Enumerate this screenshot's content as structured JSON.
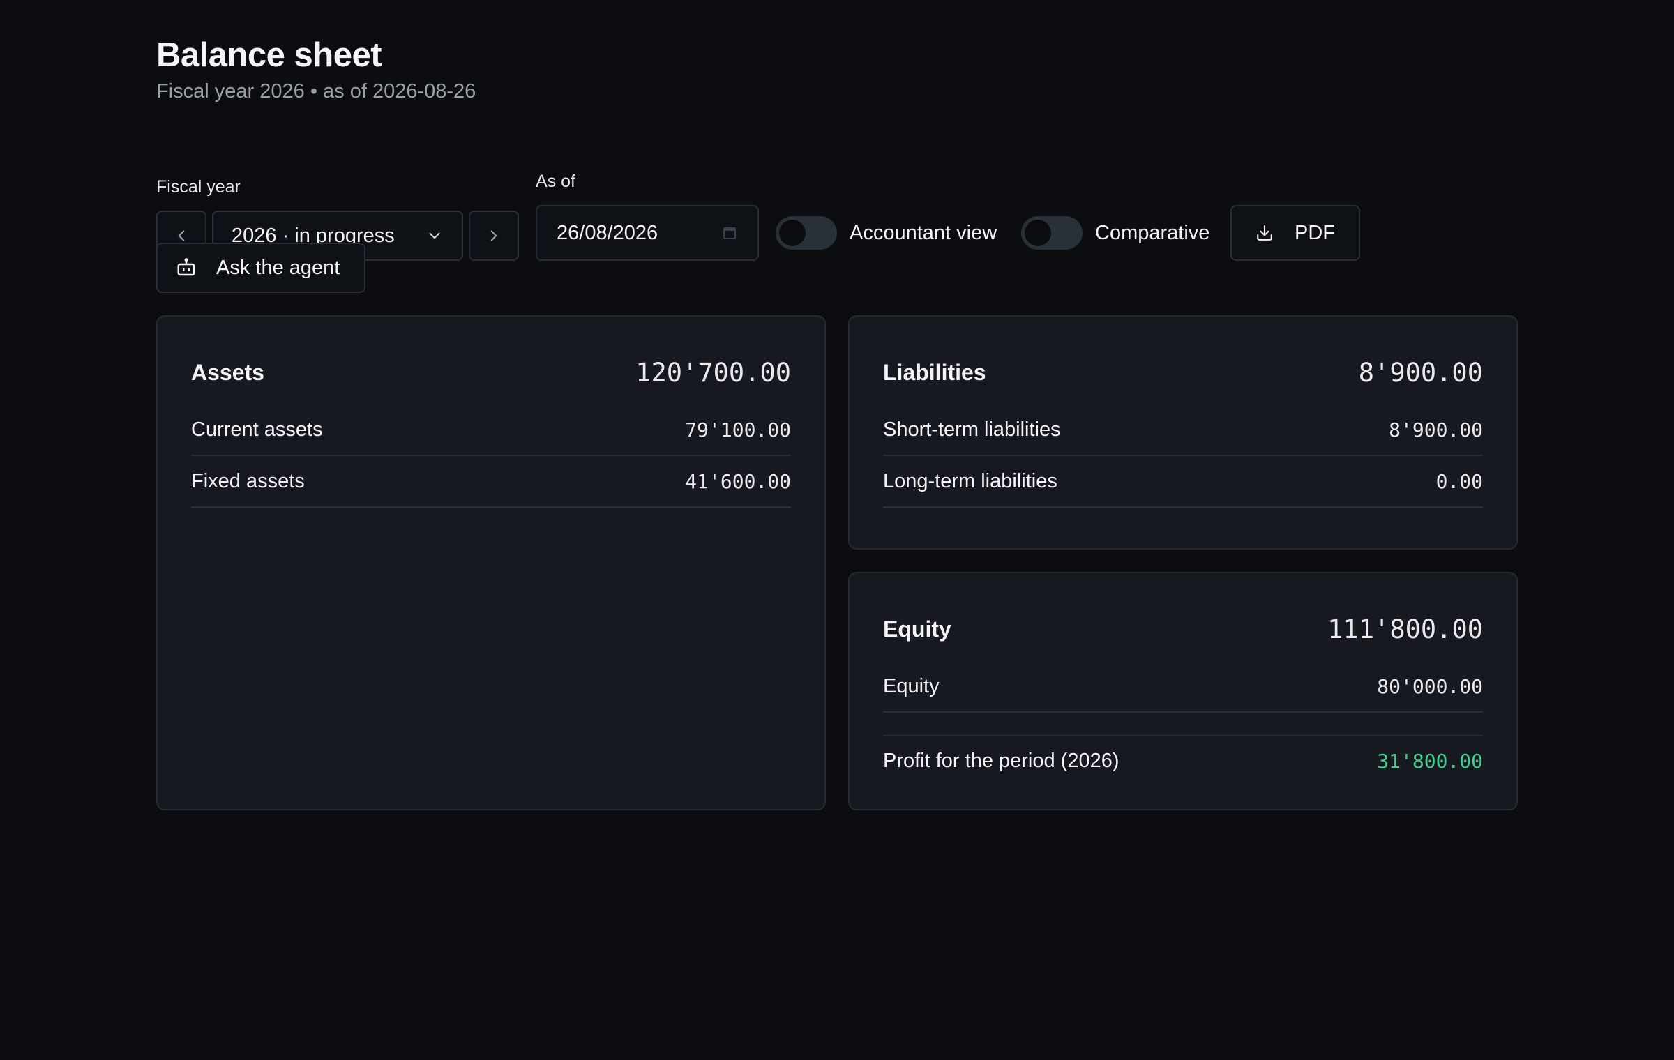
{
  "header": {
    "title": "Balance sheet",
    "subtitle": "Fiscal year 2026 • as of 2026-08-26"
  },
  "controls": {
    "fiscal_year_label": "Fiscal year",
    "fiscal_year_value": "2026 · in progress",
    "as_of_label": "As of",
    "as_of_value": "26/08/2026",
    "accountant_view_label": "Accountant view",
    "accountant_view_on": false,
    "comparative_label": "Comparative",
    "comparative_on": false,
    "pdf_label": "PDF",
    "agent_label": "Ask the agent"
  },
  "assets": {
    "title": "Assets",
    "total": "120'700.00",
    "rows": [
      {
        "label": "Current assets",
        "amount": "79'100.00"
      },
      {
        "label": "Fixed assets",
        "amount": "41'600.00"
      }
    ]
  },
  "liabilities": {
    "title": "Liabilities",
    "total": "8'900.00",
    "rows": [
      {
        "label": "Short-term liabilities",
        "amount": "8'900.00"
      },
      {
        "label": "Long-term liabilities",
        "amount": "0.00"
      }
    ]
  },
  "equity": {
    "title": "Equity",
    "total": "111'800.00",
    "rows": [
      {
        "label": "Equity",
        "amount": "80'000.00"
      }
    ],
    "profit": {
      "label": "Profit for the period (2026)",
      "amount": "31'800.00"
    }
  },
  "colors": {
    "background": "#0b0d11",
    "card": "#161a20",
    "profit_positive": "#3ecf8e"
  }
}
